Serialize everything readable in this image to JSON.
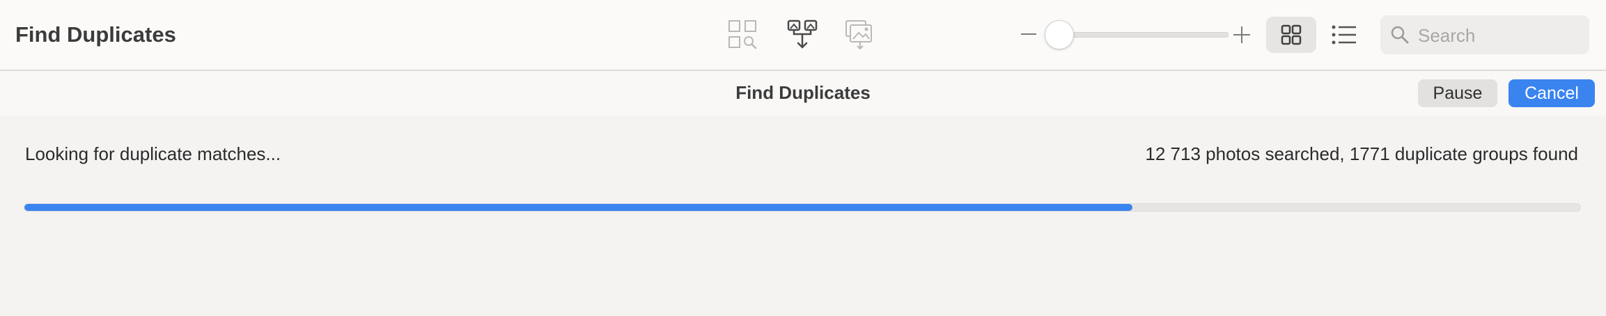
{
  "toolbar": {
    "title": "Find Duplicates",
    "icons": {
      "find": "find-duplicates-icon",
      "merge": "merge-duplicates-icon",
      "export": "export-photos-icon",
      "grid_view": "grid-view-icon",
      "list_view": "list-view-icon",
      "search": "search-icon"
    },
    "zoom": {
      "minus": "−",
      "plus": "+",
      "level": 0.0
    },
    "search": {
      "placeholder": "Search",
      "value": ""
    }
  },
  "sheet": {
    "title": "Find Duplicates",
    "pause_label": "Pause",
    "cancel_label": "Cancel"
  },
  "progress": {
    "status": "Looking for duplicate matches...",
    "summary": "12 713 photos searched, 1771 duplicate groups found",
    "fraction": 0.712
  },
  "colors": {
    "accent": "#3a84f0",
    "toolbar_bg": "#fbfaf9",
    "content_bg": "#f4f3f2"
  }
}
